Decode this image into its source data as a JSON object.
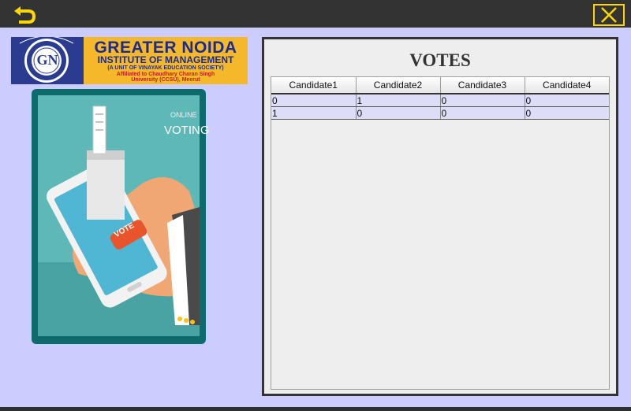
{
  "window": {
    "back_icon": "back-arrow-icon",
    "close_icon": "close-x-icon",
    "accent_color": "#ffd700"
  },
  "logo": {
    "title": "GREATER NOIDA",
    "subtitle": "INSTITUTE OF MANAGEMENT",
    "line1": "(A UNIT OF VINAYAK EDUCATION SOCIETY)",
    "line2": "Affiliated to Chaudhary Charan Singh",
    "line3": "University (CCSU), Meerut",
    "emblem_text": "GN"
  },
  "illustration": {
    "caption_line1": "ONLINE",
    "caption_line2": "VOTING",
    "button_label": "VOTE"
  },
  "votes": {
    "title": "VOTES",
    "columns": [
      "Candidate1",
      "Candidate2",
      "Candidate3",
      "Candidate4"
    ],
    "rows": [
      [
        "0",
        "1",
        "0",
        "0"
      ],
      [
        "1",
        "0",
        "0",
        "0"
      ]
    ]
  }
}
